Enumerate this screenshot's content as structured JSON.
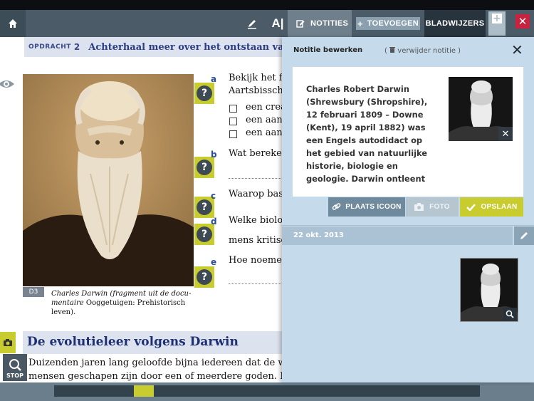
{
  "toolbar": {
    "text_tool_label": "A|",
    "tabs": {
      "notes": "NOTITIES",
      "add": "TOEVOEGEN",
      "bookmarks": "BLADWIJZERS"
    },
    "close_glyph": "✕",
    "plus_glyph": "+"
  },
  "page": {
    "assignment_label": "OPDRACHT",
    "assignment_number": "2",
    "assignment_title": "Achterhaal meer over het ontstaan van de ev",
    "photo_tag": "D3",
    "caption_italic": "Charles Darwin (fragment uit de docu-mentaire",
    "caption_plain": "Ooggetuigen: Prehistorisch leven).",
    "questions": [
      {
        "letter": "a",
        "text": "Bekijk het film"
      },
      {
        "letter": "b",
        "text": "Wat bereken"
      },
      {
        "letter": "c",
        "text": "Waarop base"
      },
      {
        "letter": "d",
        "text": "Welke bioloc"
      },
      {
        "letter": "e",
        "text": "Hoe noemen"
      }
    ],
    "question_a_line2": "Aartsbisscho",
    "question_d_line2": "mens kritisch",
    "options": [
      "een creati",
      "een aanh",
      "een aanh"
    ],
    "section_title": "De evolutieleer volgens Darwin",
    "body_line1": "Duizenden jaren lang geloofde bijna iedereen dat de werel",
    "body_line2": "mensen geschapen zijn door een of meerdere goden. Maar",
    "stop_label": "STOP",
    "help_glyph": "?"
  },
  "panel": {
    "title": "Notitie bewerken",
    "delete_label": "verwijder notitie",
    "note_text": "Charles Robert Darwin (Shrewsbury (Shropshire), 12 februari 1809 – Downe (Kent), 19 april 1882) was een Engels autodidact op het gebied van natuurlijke historie, biologie en geologie. Darwin ontleent",
    "buttons": {
      "place_icon": "PLAATS ICOON",
      "photo": "FOTO",
      "save": "OPSLAAN"
    },
    "date": "22 okt. 2013"
  },
  "colors": {
    "toolbar": "#4b5c68",
    "panel_bg": "#c5dbeb",
    "accent_yellow": "#c8cc2e",
    "close_red": "#c8223e",
    "title_blue": "#2a3d86"
  },
  "icons": [
    "home-icon",
    "pen-icon",
    "notes-icon",
    "eye-icon",
    "help-icon",
    "camera-icon",
    "magnifier-icon",
    "link-icon",
    "camera-icon",
    "check-icon",
    "trash-icon",
    "pencil-icon",
    "close-icon"
  ]
}
